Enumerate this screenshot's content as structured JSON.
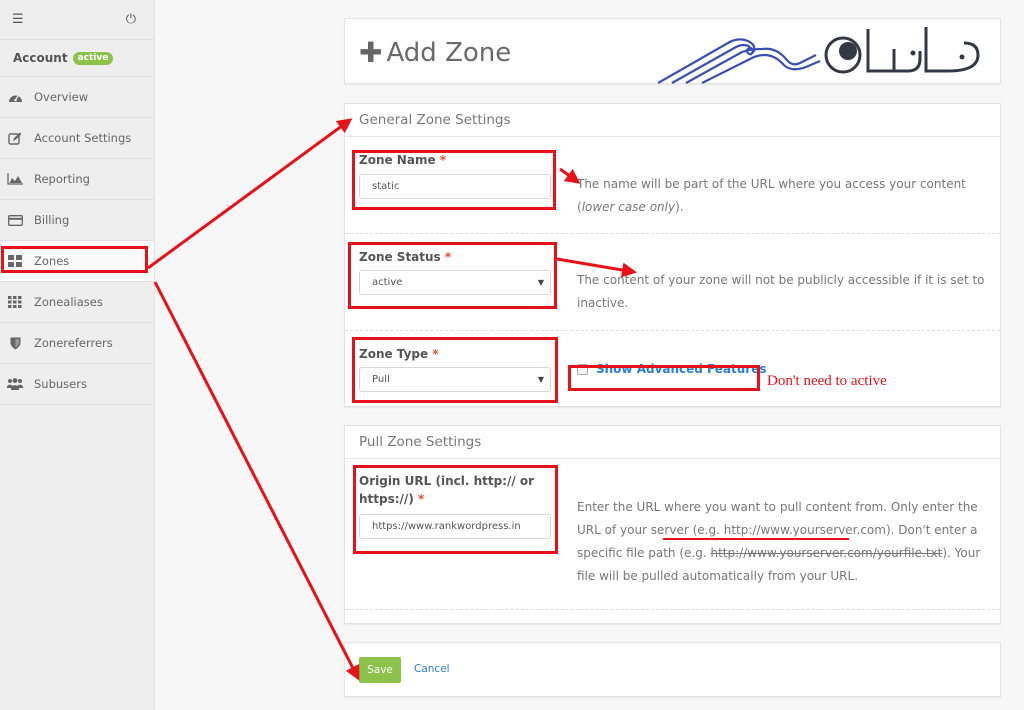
{
  "sidebar": {
    "menu_icon": "hamburger-menu-icon",
    "power_icon": "power-icon",
    "account": {
      "title": "Account",
      "badge": "active"
    },
    "items": [
      {
        "label": "Overview",
        "icon": "dashboard-gauge-icon"
      },
      {
        "label": "Account Settings",
        "icon": "edit-icon"
      },
      {
        "label": "Reporting",
        "icon": "area-chart-icon"
      },
      {
        "label": "Billing",
        "icon": "credit-card-icon"
      },
      {
        "label": "Zones",
        "icon": "grid-large-icon",
        "active": true
      },
      {
        "label": "Zonealiases",
        "icon": "grid-small-icon"
      },
      {
        "label": "Zonereferrers",
        "icon": "shield-icon"
      },
      {
        "label": "Subusers",
        "icon": "users-icon"
      }
    ]
  },
  "page": {
    "title": "Add Zone",
    "title_icon": "plus-icon"
  },
  "general": {
    "heading": "General Zone Settings",
    "zone_name": {
      "label": "Zone Name",
      "required": "*",
      "value": "static",
      "help_pre": "The name will be part of the URL where you access your content (",
      "help_em": "lower case only",
      "help_post": ")."
    },
    "zone_status": {
      "label": "Zone Status",
      "required": "*",
      "value": "active",
      "help": "The content of your zone will not be publicly accessible if it is set to inactive."
    },
    "zone_type": {
      "label": "Zone Type",
      "required": "*",
      "value": "Pull",
      "advanced_label": "Show Advanced Features",
      "advanced_checked": false
    }
  },
  "pull": {
    "heading": "Pull Zone Settings",
    "origin": {
      "label_line1": "Origin URL (incl. http:// or",
      "label_line2": "https://)",
      "required": "*",
      "value": "https://www.rankwordpress.in",
      "help_1": "Enter the URL where you want to pull content from. Only enter the URL of your server (e.g. http://www.yourserver.com). Don't enter a specific file path (e.g. ",
      "help_strike": "http://www.yourserver.com/yourfile.txt",
      "help_2": "). Your file will be pulled automatically from your URL."
    }
  },
  "actions": {
    "save": "Save",
    "cancel": "Cancel"
  },
  "annotations": {
    "note": "Don't need to active",
    "color": "#e8111a"
  },
  "colors": {
    "accent_green": "#8cc14c",
    "link_blue": "#2a7fd4",
    "required_red": "#e74c3c"
  }
}
